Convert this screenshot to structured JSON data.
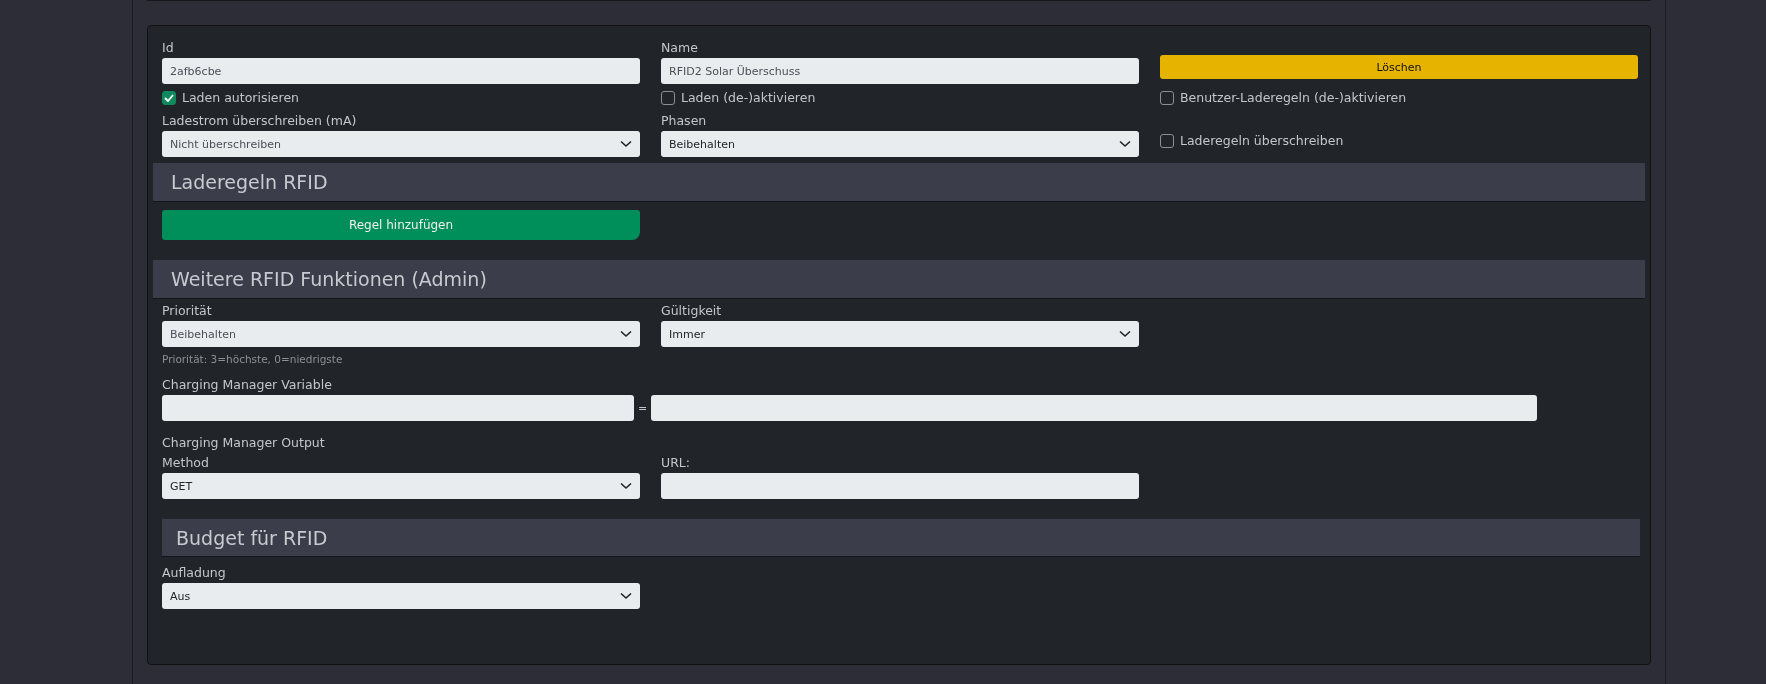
{
  "fields": {
    "id": {
      "label": "Id",
      "value": "2afb6cbe"
    },
    "name": {
      "label": "Name",
      "value": "RFID2 Solar Überschuss"
    }
  },
  "delete_button": "Löschen",
  "checkboxes": [
    {
      "label": "Laden autorisieren",
      "checked": true
    },
    {
      "label": "Laden (de-)aktivieren",
      "checked": false
    },
    {
      "label": "Benutzer-Laderegeln (de-)aktivieren",
      "checked": false
    }
  ],
  "current_override": {
    "label": "Ladestrom überschreiben (mA)",
    "value": "Nicht überschreiben"
  },
  "phases": {
    "label": "Phasen",
    "value": "Beibehalten"
  },
  "override_rules": {
    "label": "Laderegeln überschreiben",
    "checked": false
  },
  "rules_section": {
    "title": "Laderegeln RFID",
    "add_button": "Regel hinzufügen"
  },
  "admin_section": {
    "title": "Weitere RFID Funktionen (Admin)",
    "priority": {
      "label": "Priorität",
      "value": "Beibehalten",
      "hint": "Priorität: 3=höchste, 0=niedrigste"
    },
    "validity": {
      "label": "Gültigkeit",
      "value": "Immer"
    },
    "variable": {
      "label": "Charging Manager Variable",
      "separator": "="
    },
    "output": {
      "label": "Charging Manager Output",
      "method_label": "Method",
      "method_value": "GET",
      "url_label": "URL:"
    }
  },
  "budget_section": {
    "title": "Budget für RFID",
    "charge": {
      "label": "Aufladung",
      "value": "Aus"
    }
  }
}
